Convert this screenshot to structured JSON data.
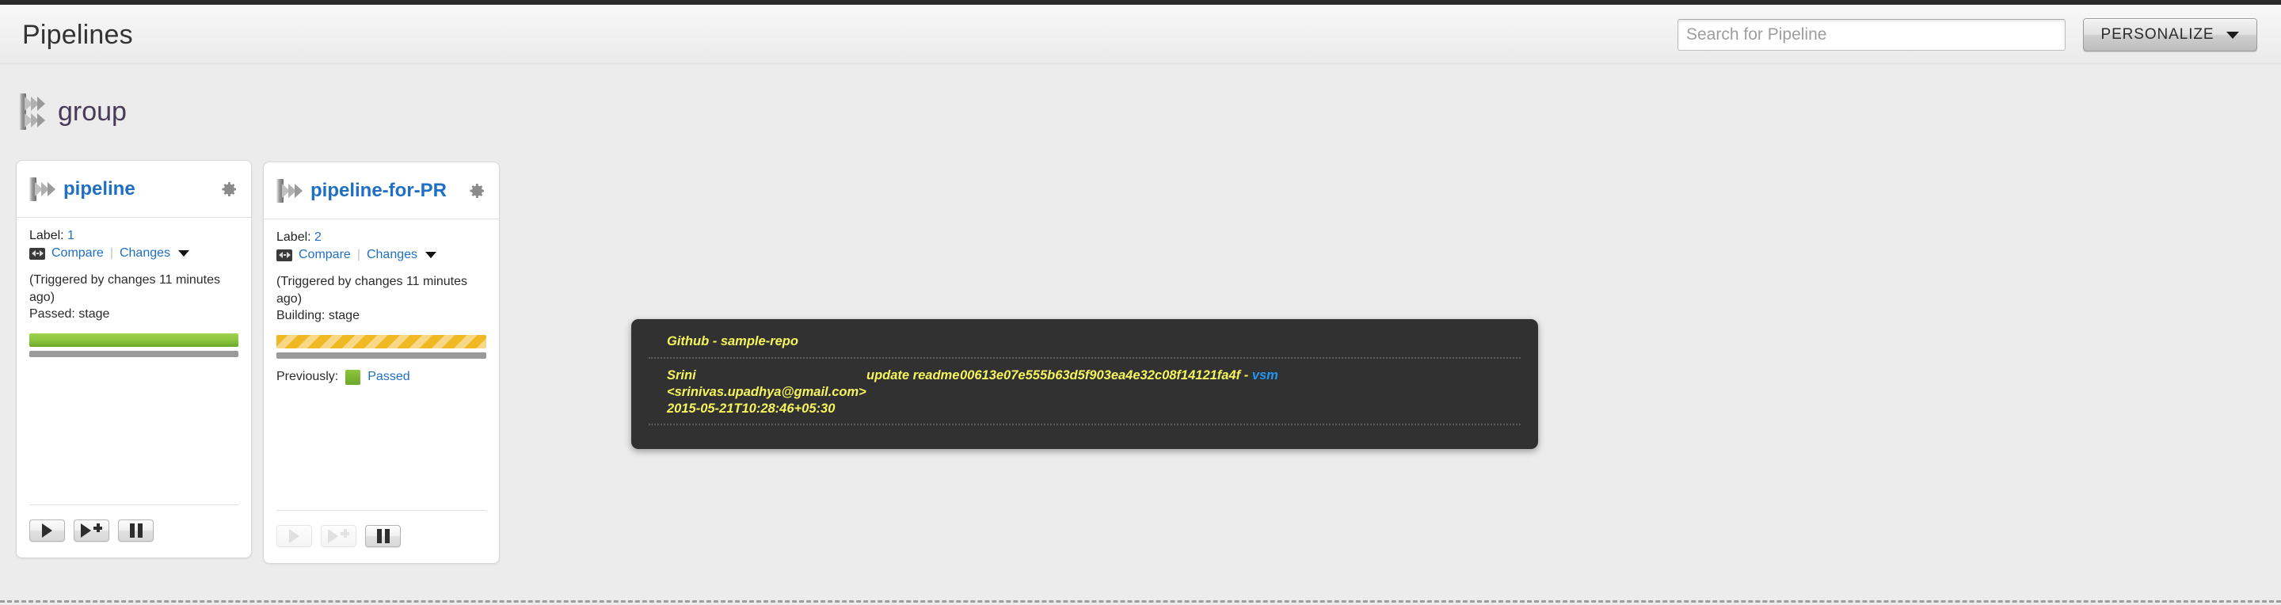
{
  "header": {
    "title": "Pipelines",
    "search": {
      "placeholder": "Search for Pipeline",
      "value": ""
    },
    "personalize_label": "PERSONALIZE",
    "icons": {
      "caret": "chevron-down-icon"
    }
  },
  "group": {
    "name": "group",
    "icon": "pipeline-group-icon"
  },
  "cards": [
    {
      "name": "pipeline",
      "gear": "gear-icon",
      "label_prefix": "Label:",
      "label_value": "1",
      "compare_label": "Compare",
      "changes_label": "Changes",
      "separator": "|",
      "trigger_text": "(Triggered by changes 11 minutes ago)",
      "status_text": "Passed: stage",
      "bar_state": "passed",
      "has_previously": false,
      "previously_label": "",
      "previously_link": "",
      "buttons": [
        {
          "name": "trigger-button",
          "icon": "play-icon",
          "enabled": true
        },
        {
          "name": "trigger-with-options-button",
          "icon": "play-plus-icon",
          "enabled": true
        },
        {
          "name": "pause-button",
          "icon": "pause-icon",
          "enabled": true
        }
      ]
    },
    {
      "name": "pipeline-for-PR",
      "gear": "gear-icon",
      "label_prefix": "Label:",
      "label_value": "2",
      "compare_label": "Compare",
      "changes_label": "Changes",
      "separator": "|",
      "trigger_text": "(Triggered by changes 11 minutes ago)",
      "status_text": "Building: stage",
      "bar_state": "building",
      "has_previously": true,
      "previously_label": "Previously:",
      "previously_link": "Passed",
      "buttons": [
        {
          "name": "trigger-button",
          "icon": "play-icon",
          "enabled": false
        },
        {
          "name": "trigger-with-options-button",
          "icon": "play-plus-icon",
          "enabled": false
        },
        {
          "name": "pause-button",
          "icon": "pause-icon",
          "enabled": true
        }
      ]
    }
  ],
  "tooltip": {
    "material": "Github - sample-repo",
    "author": "Srini <srinivas.upadhya@gmail.com>",
    "timestamp": "2015-05-21T10:28:46+05:30",
    "message": "update readme",
    "revision": "00613e07e555b63d5f903ea4e32c08f14121fa4f - ",
    "revision_link": "vsm"
  },
  "colors": {
    "link_blue": "#1f6fc4",
    "tooltip_bg": "#313131",
    "tooltip_text": "#f5f45c",
    "tooltip_link": "#2196f3",
    "passed_green": "#8ec63f",
    "building_yellow": "#f0b823",
    "group_purple": "#4a3a5a"
  }
}
